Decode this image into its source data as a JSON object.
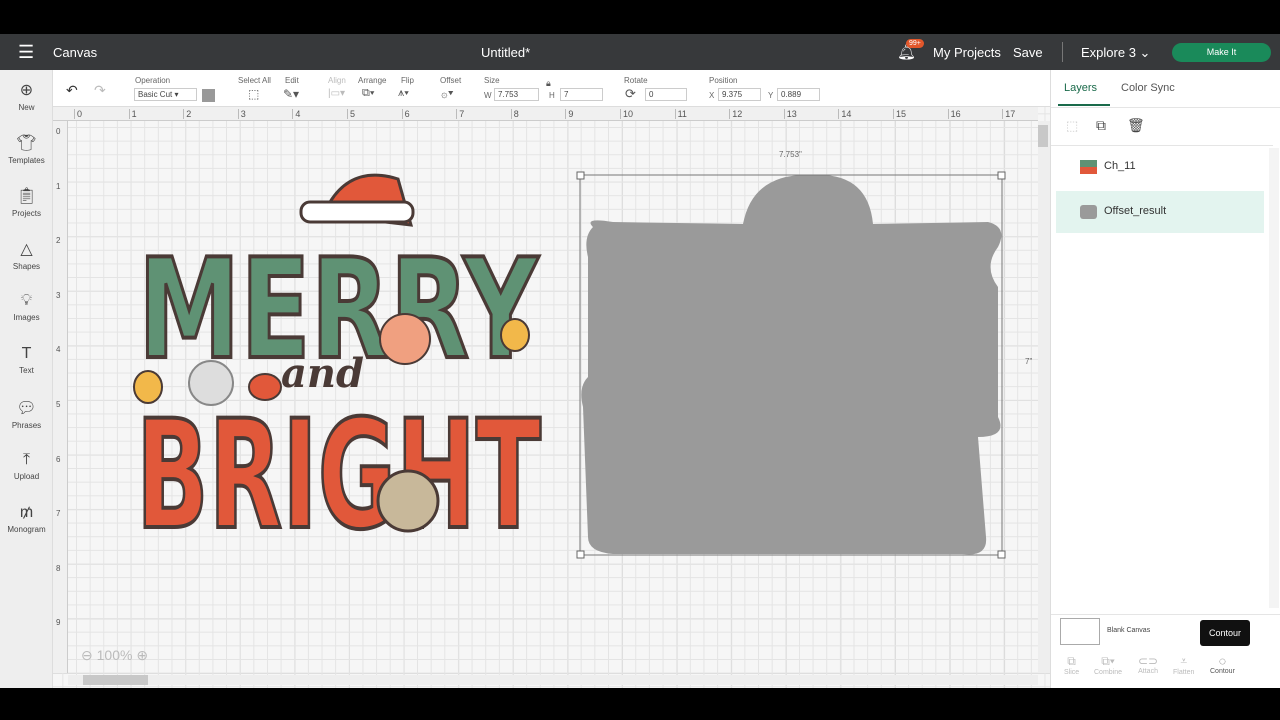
{
  "header": {
    "app": "Canvas",
    "title": "Untitled*",
    "notification_badge": "99+",
    "my_projects": "My Projects",
    "save": "Save",
    "machine": "Explore 3",
    "make_it": "Make It"
  },
  "toolbar": {
    "operation_label": "Operation",
    "operation_value": "Basic Cut",
    "select_all": "Select All",
    "edit": "Edit",
    "align": "Align",
    "arrange": "Arrange",
    "flip": "Flip",
    "offset": "Offset",
    "size": "Size",
    "w_label": "W",
    "w": "7.753",
    "h_label": "H",
    "h": "7",
    "rotate": "Rotate",
    "rotate_value": "0",
    "position": "Position",
    "x_label": "X",
    "x": "9.375",
    "y_label": "Y",
    "y": "0.889"
  },
  "sidebar": {
    "items": [
      {
        "label": "New",
        "icon": "plus-circle-icon"
      },
      {
        "label": "Templates",
        "icon": "shirt-icon"
      },
      {
        "label": "Projects",
        "icon": "clipboard-icon"
      },
      {
        "label": "Shapes",
        "icon": "shapes-icon"
      },
      {
        "label": "Images",
        "icon": "bulb-icon"
      },
      {
        "label": "Text",
        "icon": "text-icon"
      },
      {
        "label": "Phrases",
        "icon": "speech-icon"
      },
      {
        "label": "Upload",
        "icon": "upload-icon"
      },
      {
        "label": "Monogram",
        "icon": "monogram-icon"
      }
    ]
  },
  "rulers": {
    "h": [
      "0",
      "1",
      "2",
      "3",
      "4",
      "5",
      "6",
      "7",
      "8",
      "9",
      "10",
      "11",
      "12",
      "13",
      "14",
      "15",
      "16",
      "17"
    ],
    "v": [
      "0",
      "1",
      "2",
      "3",
      "4",
      "5",
      "6",
      "7",
      "8",
      "9"
    ]
  },
  "canvas": {
    "width_label": "7.753\"",
    "height_label": "7\"",
    "zoom": "100%",
    "art": {
      "line1": "MERRY",
      "line2": "and",
      "line3": "BRIGHT"
    },
    "colors": {
      "green": "#5f9274",
      "red": "#e1583a",
      "pink": "#e88878",
      "outline": "#4a3a36",
      "offset": "#9a9a9a"
    }
  },
  "panel": {
    "tabs": [
      "Layers",
      "Color Sync"
    ],
    "layers": [
      {
        "name": "Ch_11"
      },
      {
        "name": "Offset_result",
        "selected": true
      }
    ],
    "blank_canvas": "Blank Canvas",
    "tooltip": "Contour",
    "actions": [
      "Slice",
      "Combine",
      "Attach",
      "Flatten",
      "Contour"
    ]
  },
  "accent": "#1a8a5a"
}
